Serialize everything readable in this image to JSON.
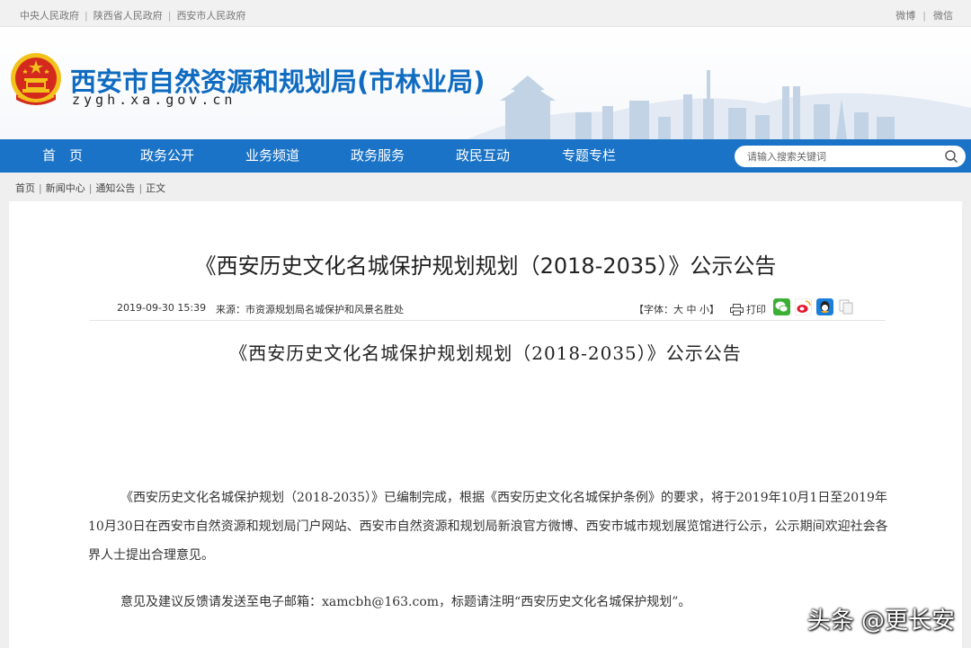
{
  "topbar": {
    "links": [
      "中央人民政府",
      "陕西省人民政府",
      "西安市人民政府"
    ],
    "separator": "|",
    "social": [
      "微博",
      "微信"
    ]
  },
  "header": {
    "title": "西安市自然资源和规划局(市林业局)",
    "domain": "zygh.xa.gov.cn"
  },
  "nav": {
    "items": [
      "首　页",
      "政务公开",
      "业务频道",
      "政务服务",
      "政民互动",
      "专题专栏"
    ],
    "search_placeholder": "请输入搜索关键词"
  },
  "breadcrumb": [
    "首页",
    "新闻中心",
    "通知公告",
    "正文"
  ],
  "article": {
    "title": "《西安历史文化名城保护规划规划（2018-2035）》公示公告",
    "date": "2019-09-30 15:39",
    "source": "来源：市资源规划局名城保护和风景名胜处",
    "fontsize_label": "【字体：",
    "fontsize_options": [
      "大",
      "中",
      "小"
    ],
    "fontsize_close": "】",
    "print_label": "打印",
    "subtitle": "《西安历史文化名城保护规划规划（2018-2035）》公示公告",
    "paragraph1": "《西安历史文化名城保护规划（2018-2035）》已编制完成，根据《西安历史文化名城保护条例》的要求，将于2019年10月1日至2019年10月30日在西安市自然资源和规划局门户网站、西安市自然资源和规划局新浪官方微博、西安市城市规划展览馆进行公示，公示期间欢迎社会各界人士提出合理意见。",
    "paragraph2": "意见及建议反馈请发送至电子邮箱：xamcbh@163.com，标题请注明“西安历史文化名城保护规划”。"
  },
  "watermark": "头条 @更长安",
  "colors": {
    "nav_blue": "#1a73c6",
    "title_blue": "#0f6bc0",
    "emblem_red": "#d42a1e",
    "emblem_gold": "#f2c21b"
  }
}
